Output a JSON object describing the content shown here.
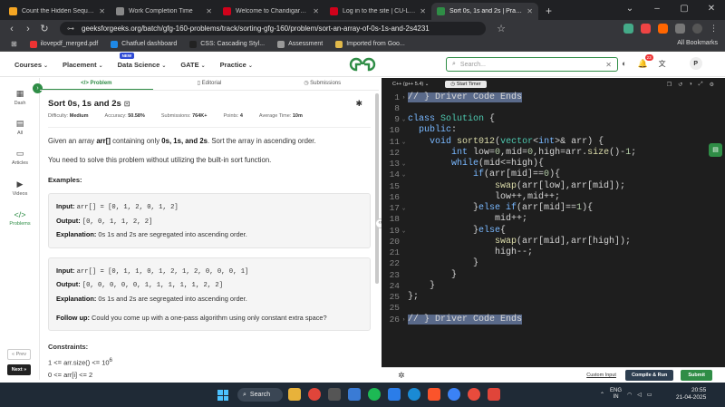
{
  "browser": {
    "tabs": [
      {
        "label": "Count the Hidden Sequences - Leetcode",
        "color": "#f5a623",
        "active": false
      },
      {
        "label": "Work Completion Time",
        "color": "#888888",
        "active": false
      },
      {
        "label": "Welcome to Chandigarh University",
        "color": "#d0021b",
        "active": false
      },
      {
        "label": "Log in to the site | CU-LMS",
        "color": "#d0021b",
        "active": false
      },
      {
        "label": "Sort 0s, 1s and 2s | Practice | GeeksforGeeks",
        "color": "#2f8d46",
        "active": true
      }
    ],
    "url": "geeksforgeeks.org/batch/gfg-160-problems/track/sorting-gfg-160/problem/sort-an-array-of-0s-1s-and-2s4231",
    "bookmarks": [
      {
        "label": "ilovepdf_merged.pdf",
        "color": "#e33"
      },
      {
        "label": "Chatfuel dashboard",
        "color": "#1e88e5"
      },
      {
        "label": "CSS: Cascading Styl...",
        "color": "#222"
      },
      {
        "label": "Assessment",
        "color": "#999"
      },
      {
        "label": "Imported from Goo...",
        "color": "#e0b84a"
      }
    ],
    "all_bookmarks": "All Bookmarks"
  },
  "gfg_nav": {
    "items": [
      "Courses",
      "Placement",
      "Data Science",
      "GATE",
      "Practice"
    ],
    "new_badge": "NEW",
    "search_placeholder": "Search...",
    "notif_count": "23",
    "avatar": "P"
  },
  "sidebar": {
    "items": [
      "Dash",
      "All",
      "Articles",
      "Videos",
      "Problems"
    ],
    "prev": "« Prev",
    "next": "Next »"
  },
  "problem": {
    "tabs": [
      "Problem",
      "Editorial",
      "Submissions"
    ],
    "title": "Sort 0s, 1s and 2s",
    "meta": {
      "difficulty_label": "Difficulty:",
      "difficulty": "Medium",
      "accuracy_label": "Accuracy:",
      "accuracy": "50.58%",
      "submissions_label": "Submissions:",
      "submissions": "764K+",
      "points_label": "Points:",
      "points": "4",
      "time_label": "Average Time:",
      "time": "10m"
    },
    "desc1_pre": "Given an array ",
    "desc1_b1": "arr[]",
    "desc1_mid": " containing only ",
    "desc1_b2": "0s, 1s, and 2s",
    "desc1_post": ". Sort the array in ascending order.",
    "desc2": "You need to solve this problem without utilizing the built-in sort function.",
    "examples_heading": "Examples:",
    "examples": [
      {
        "input": "arr[] = [0, 1, 2, 0, 1, 2]",
        "output": "[0, 0, 1, 1, 2, 2]",
        "explanation": "0s 1s and 2s are segregated into ascending order."
      },
      {
        "input": "arr[] = [0, 1, 1, 0, 1, 2, 1, 2, 0, 0, 0, 1]",
        "output": "[0, 0, 0, 0, 0, 1, 1, 1, 1, 1, 2, 2]",
        "explanation": "0s 1s and 2s are segregated into ascending order."
      }
    ],
    "input_label": "Input:",
    "output_label": "Output:",
    "explanation_label": "Explanation:",
    "followup_label": "Follow up:",
    "followup": "Could you come up with a one-pass algorithm using only constant extra space?",
    "constraints_heading": "Constraints:",
    "constraint1": "1 <= arr.size() <= 10",
    "constraint1_exp": "6",
    "constraint2": "0 <= arr[i] <= 2"
  },
  "editor": {
    "language": "C++ (g++ 5.4)",
    "timer": "Start Timer",
    "custom_input": "Custom Input",
    "compile_run": "Compile & Run",
    "submit": "Submit",
    "line_numbers": [
      "1",
      "8",
      "9",
      "10",
      "11",
      "12",
      "13",
      "14",
      "15",
      "16",
      "17",
      "18",
      "19",
      "20",
      "21",
      "22",
      "23",
      "24",
      "25",
      "26"
    ]
  },
  "taskbar": {
    "search": "Search",
    "lang1": "ENG",
    "lang2": "IN",
    "time": "20:55",
    "date": "21-04-2025"
  }
}
